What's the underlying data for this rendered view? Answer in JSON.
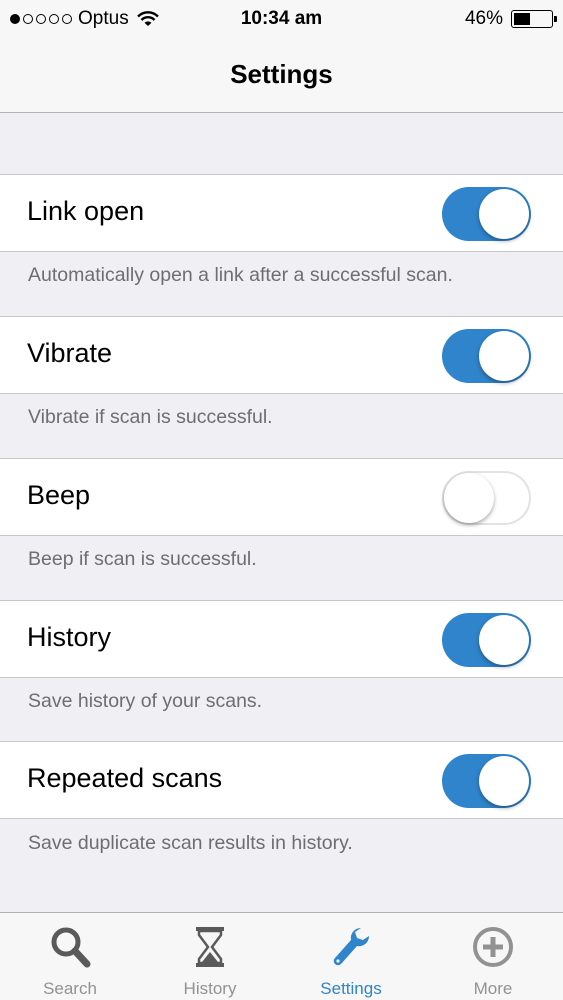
{
  "status_bar": {
    "carrier": "Optus",
    "time": "10:34 am",
    "battery": "46%",
    "battery_level": 0.46,
    "signal_bars": 1
  },
  "nav": {
    "title": "Settings"
  },
  "settings": [
    {
      "label": "Link open",
      "description": "Automatically open a link after a successful scan.",
      "enabled": true
    },
    {
      "label": "Vibrate",
      "description": "Vibrate if scan is successful.",
      "enabled": true
    },
    {
      "label": "Beep",
      "description": "Beep if scan is successful.",
      "enabled": false
    },
    {
      "label": "History",
      "description": "Save history of your scans.",
      "enabled": true
    },
    {
      "label": "Repeated scans",
      "description": "Save duplicate scan results in history.",
      "enabled": true
    }
  ],
  "tabs": [
    {
      "label": "Search",
      "icon": "search-icon",
      "active": false
    },
    {
      "label": "History",
      "icon": "hourglass-icon",
      "active": false
    },
    {
      "label": "Settings",
      "icon": "wrench-icon",
      "active": true
    },
    {
      "label": "More",
      "icon": "plus-circle-icon",
      "active": false
    }
  ],
  "colors": {
    "accent": "#2f84cc",
    "background": "#efeff4",
    "inactive_tab": "#929292",
    "description": "#6d6d72"
  }
}
